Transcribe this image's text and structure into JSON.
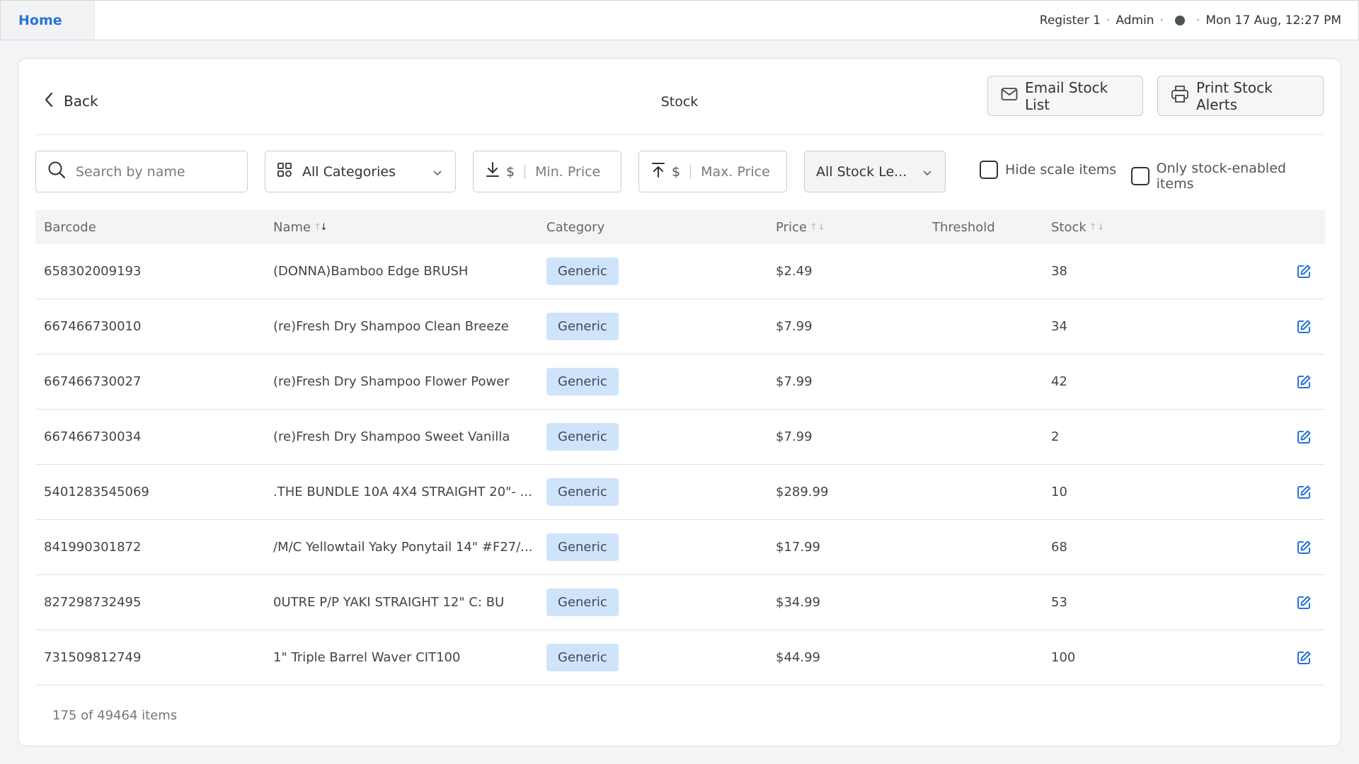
{
  "topbar": {
    "home_tab": "Home",
    "register": "Register 1",
    "user": "Admin",
    "datetime": "Mon 17 Aug, 12:27 PM",
    "separator": "·"
  },
  "header": {
    "back_label": "Back",
    "title": "Stock",
    "email_button": "Email Stock List",
    "print_button": "Print Stock Alerts"
  },
  "filters": {
    "search_placeholder": "Search by name",
    "category_value": "All Categories",
    "currency": "$",
    "min_price_placeholder": "Min. Price",
    "max_price_placeholder": "Max. Price",
    "stock_level_value": "All Stock Le...",
    "hide_scale_label": "Hide scale items",
    "hide_scale_checked": false,
    "only_stock_label": "Only stock-enabled items",
    "only_stock_checked": false
  },
  "table": {
    "columns": {
      "barcode": "Barcode",
      "name": "Name",
      "category": "Category",
      "price": "Price",
      "threshold": "Threshold",
      "stock": "Stock"
    },
    "rows": [
      {
        "barcode": "658302009193",
        "name": "(DONNA)Bamboo Edge BRUSH",
        "category": "Generic",
        "price": "$2.49",
        "threshold": "",
        "stock": "38"
      },
      {
        "barcode": "667466730010",
        "name": "(re)Fresh Dry Shampoo Clean Breeze",
        "category": "Generic",
        "price": "$7.99",
        "threshold": "",
        "stock": "34"
      },
      {
        "barcode": "667466730027",
        "name": "(re)Fresh Dry Shampoo Flower Power",
        "category": "Generic",
        "price": "$7.99",
        "threshold": "",
        "stock": "42"
      },
      {
        "barcode": "667466730034",
        "name": "(re)Fresh Dry Shampoo Sweet Vanilla",
        "category": "Generic",
        "price": "$7.99",
        "threshold": "",
        "stock": "2"
      },
      {
        "barcode": "5401283545069",
        "name": ".THE BUNDLE 10A 4X4 STRAIGHT 20\"- ...",
        "category": "Generic",
        "price": "$289.99",
        "threshold": "",
        "stock": "10"
      },
      {
        "barcode": "841990301872",
        "name": "/M/C Yellowtail Yaky Ponytail 14\" #F27/...",
        "category": "Generic",
        "price": "$17.99",
        "threshold": "",
        "stock": "68"
      },
      {
        "barcode": "827298732495",
        "name": "0UTRE P/P YAKI STRAIGHT 12\"  C: BU",
        "category": "Generic",
        "price": "$34.99",
        "threshold": "",
        "stock": "53"
      },
      {
        "barcode": "731509812749",
        "name": "1\" Triple Barrel Waver CIT100",
        "category": "Generic",
        "price": "$44.99",
        "threshold": "",
        "stock": "100"
      }
    ]
  },
  "footer": {
    "count_text": "175 of 49464 items"
  },
  "colors": {
    "accent": "#2474d6",
    "badge_bg": "#cfe4fb",
    "status_dot": "#4b5452"
  },
  "icons": {
    "back": "chevron-left-icon",
    "email": "envelope-icon",
    "print": "printer-icon",
    "search": "search-icon",
    "category": "grid-icon",
    "min_price": "arrow-down-to-line-icon",
    "max_price": "arrow-up-to-line-icon",
    "dropdown": "chevron-down-icon",
    "edit": "edit-icon"
  }
}
